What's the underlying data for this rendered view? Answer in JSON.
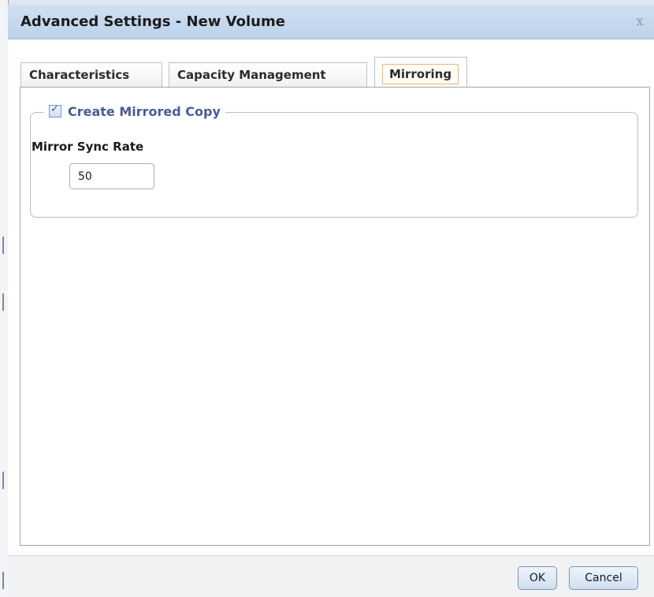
{
  "dialog": {
    "title": "Advanced Settings - New Volume",
    "close_glyph": "x"
  },
  "tabs": [
    {
      "label": "Characteristics",
      "active": false
    },
    {
      "label": "Capacity Management",
      "active": false
    },
    {
      "label": "Mirroring",
      "active": true
    }
  ],
  "mirroring": {
    "create_mirrored_copy_label": "Create Mirrored Copy",
    "create_mirrored_copy_checked": true,
    "mirror_sync_rate_label": "Mirror Sync Rate",
    "mirror_sync_rate_value": "50"
  },
  "footer": {
    "ok_label": "OK",
    "cancel_label": "Cancel"
  },
  "colors": {
    "title_bar": "#bcd2ea",
    "legend_text": "#4a5a9a",
    "active_tab_border": "#e8b86a",
    "button_border": "#7f95b1"
  },
  "icons": {
    "close": "close-icon",
    "checkbox": "checkbox-checked-icon"
  }
}
